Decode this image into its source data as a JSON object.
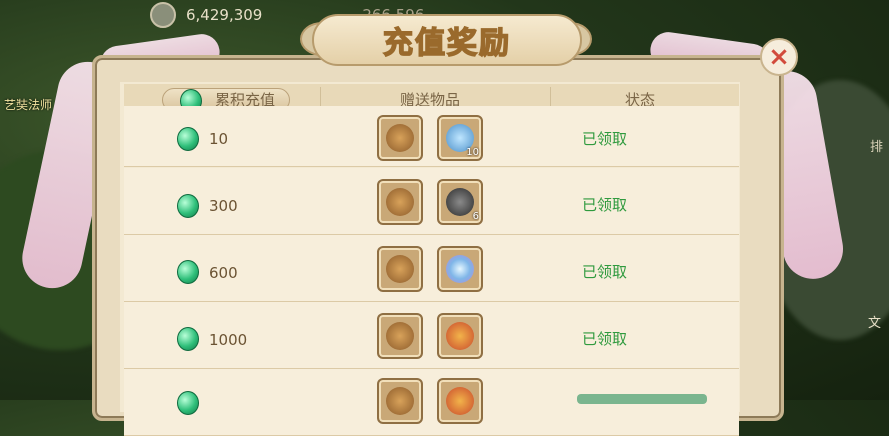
{
  "hud": {
    "coins": "6,429,309",
    "gems": "266,596"
  },
  "side": {
    "left_label": "艺奘法师",
    "right_label_a": "排",
    "right_label_b": "文"
  },
  "dialog": {
    "title": "充值奖励",
    "close": "×"
  },
  "table": {
    "columns": [
      "累积充值",
      "赠送物品",
      "状态"
    ],
    "rows": [
      {
        "amount": "10",
        "items": [
          {
            "name": "gift-bag"
          },
          {
            "name": "potion",
            "count": "10"
          }
        ],
        "status": "已领取"
      },
      {
        "amount": "300",
        "items": [
          {
            "name": "gift-bag"
          },
          {
            "name": "ore",
            "count": "6"
          }
        ],
        "status": "已领取"
      },
      {
        "amount": "600",
        "items": [
          {
            "name": "gift-bag"
          },
          {
            "name": "orb"
          }
        ],
        "status": "已领取"
      },
      {
        "amount": "1000",
        "items": [
          {
            "name": "gift-bag"
          },
          {
            "name": "pouch"
          }
        ],
        "status": "已领取"
      },
      {
        "amount": "",
        "items": [
          {
            "name": "gift-bag"
          },
          {
            "name": "pouch"
          }
        ],
        "status": ""
      }
    ]
  },
  "colors": {
    "accent_green": "#2f9a3e",
    "gem": "#2fbf7a"
  }
}
